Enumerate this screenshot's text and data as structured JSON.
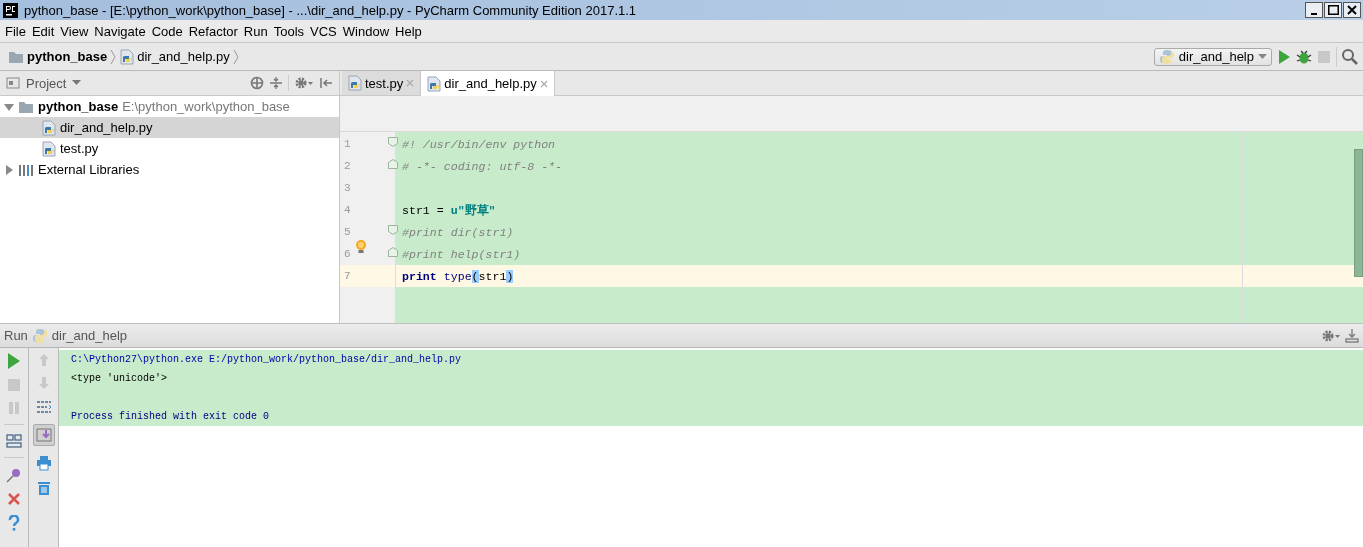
{
  "window": {
    "title": "python_base - [E:\\python_work\\python_base] - ...\\dir_and_help.py - PyCharm Community Edition 2017.1.1"
  },
  "menu": [
    "File",
    "Edit",
    "View",
    "Navigate",
    "Code",
    "Refactor",
    "Run",
    "Tools",
    "VCS",
    "Window",
    "Help"
  ],
  "breadcrumbs": [
    {
      "label": "python_base",
      "kind": "folder"
    },
    {
      "label": "dir_and_help.py",
      "kind": "file"
    }
  ],
  "run_config": {
    "label": "dir_and_help"
  },
  "project_panel": {
    "title": "Project",
    "tree": [
      {
        "label": "python_base",
        "path": "E:\\python_work\\python_base",
        "kind": "folder",
        "expanded": true,
        "selected": false,
        "children": [
          {
            "label": "dir_and_help.py",
            "kind": "file",
            "selected": true
          },
          {
            "label": "test.py",
            "kind": "file",
            "selected": false
          }
        ]
      },
      {
        "label": "External Libraries",
        "kind": "library",
        "expanded": false,
        "selected": false
      }
    ]
  },
  "editor": {
    "tabs": [
      {
        "label": "test.py",
        "selected": false
      },
      {
        "label": "dir_and_help.py",
        "selected": true
      }
    ],
    "lines": [
      {
        "number": "1",
        "current": false,
        "fold_open": true,
        "tokens": [
          {
            "kind": "comment",
            "text": "#! /usr/bin/env python"
          }
        ]
      },
      {
        "number": "2",
        "current": false,
        "fold_close": true,
        "tokens": [
          {
            "kind": "comment",
            "text": "# -*- coding: utf-8 -*-"
          }
        ]
      },
      {
        "number": "3",
        "current": false
      },
      {
        "number": "4",
        "current": false,
        "tokens": [
          {
            "kind": "plain",
            "text": "str1 = "
          },
          {
            "kind": "string",
            "text": "u\"野草\""
          }
        ]
      },
      {
        "number": "5",
        "current": false,
        "fold_open": true,
        "tokens": [
          {
            "kind": "comment",
            "text": "#print dir(str1)"
          }
        ]
      },
      {
        "number": "6",
        "current": false,
        "fold_close": true,
        "bulb": true,
        "tokens": [
          {
            "kind": "comment",
            "text": "#print help(str1)"
          }
        ]
      },
      {
        "number": "7",
        "current": true,
        "tokens": [
          {
            "kind": "keyword",
            "text": "print"
          },
          {
            "kind": "builtin",
            "text": " type"
          },
          {
            "kind": "brace",
            "text": "("
          },
          {
            "kind": "plain",
            "text": "str1"
          },
          {
            "kind": "brace",
            "text": ")"
          }
        ]
      }
    ]
  },
  "run_panel": {
    "title": "Run",
    "config": "dir_and_help",
    "output": [
      {
        "kind": "command",
        "text": "C:\\Python27\\python.exe E:/python_work/python_base/dir_and_help.py"
      },
      {
        "kind": "output",
        "text": "<type 'unicode'>"
      },
      {
        "kind": "exit",
        "text": "Process finished with exit code 0"
      }
    ]
  }
}
